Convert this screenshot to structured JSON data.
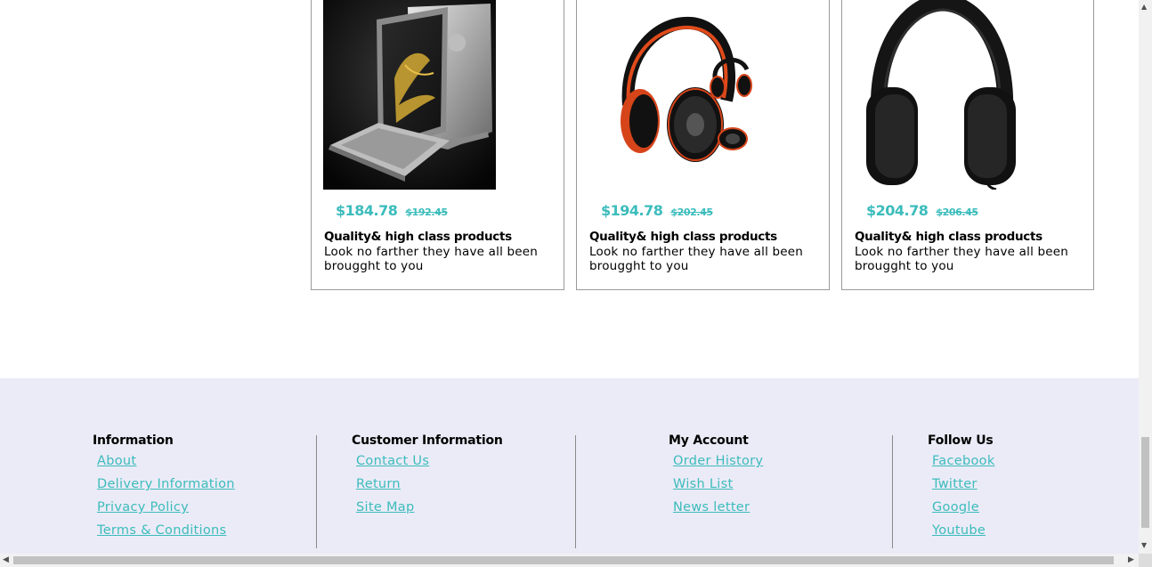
{
  "products": [
    {
      "image": "laptop-tablet-image",
      "price": "$184.78",
      "old_price": "$192.45",
      "title": "Quality& high class products",
      "description": "Look no farther they have all been brougght to you"
    },
    {
      "image": "headphones-red-image",
      "price": "$194.78",
      "old_price": "$202.45",
      "title": "Quality& high class products",
      "description": "Look no farther they have all been brougght to you"
    },
    {
      "image": "headphones-black-image",
      "price": "$204.78",
      "old_price": "$206.45",
      "title": "Quality& high class products",
      "description": "Look no farther they have all been brougght to you"
    }
  ],
  "footer": {
    "information": {
      "heading": "Information",
      "links": [
        "About",
        "Delivery Information",
        "Privacy Policy",
        "Terms & Conditions"
      ]
    },
    "customer_information": {
      "heading": "Customer Information",
      "links": [
        "Contact Us",
        "Return",
        "Site Map"
      ]
    },
    "my_account": {
      "heading": "My Account",
      "links": [
        "Order History",
        "Wish List",
        "News letter"
      ]
    },
    "follow_us": {
      "heading": "Follow Us",
      "links": [
        "Facebook",
        "Twitter",
        "Google",
        "Youtube"
      ]
    }
  },
  "colors": {
    "accent": "#3cbcbc",
    "footer_background": "#ebebf7",
    "card_border": "#9a9a9a"
  },
  "icons": {
    "scroll_up": "triangle-up-icon",
    "scroll_down": "triangle-down-icon",
    "scroll_left": "triangle-left-icon",
    "scroll_right": "triangle-right-icon"
  }
}
